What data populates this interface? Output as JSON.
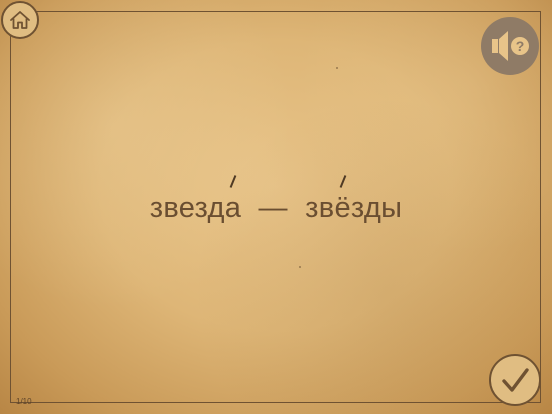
{
  "exercise": {
    "word_singular_pre": "звезд",
    "word_singular_stressed": "а",
    "dash": "—",
    "word_plural_pre": "зв",
    "word_plural_stressed": "ё",
    "word_plural_post": "зды"
  },
  "progress": {
    "label": "1/10",
    "current": 1,
    "total": 10
  },
  "icons": {
    "home": "home-icon",
    "sound_help": "speaker-question-icon",
    "check": "checkmark-icon"
  },
  "colors": {
    "paper": "#deb677",
    "ink": "#6a4e31",
    "button_dark": "#8f7b66"
  }
}
